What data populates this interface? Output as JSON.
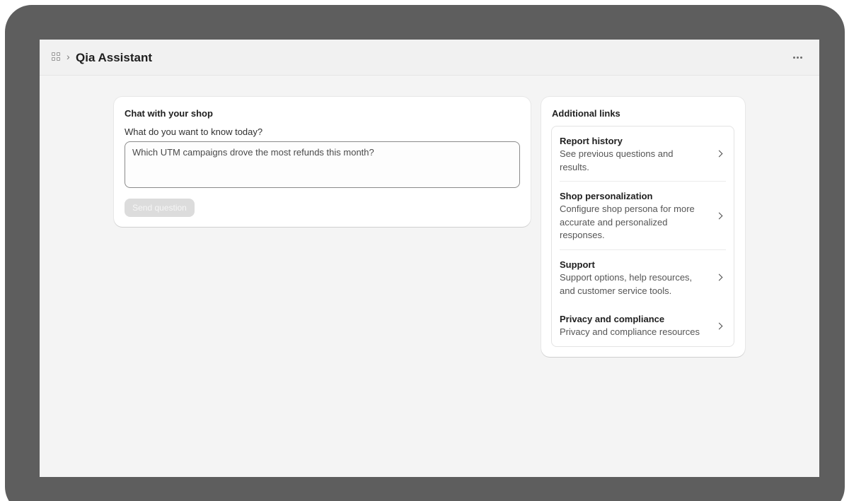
{
  "header": {
    "breadcrumb_separator": "›",
    "title": "Qia Assistant",
    "more_icon": "more-horizontal-icon"
  },
  "chat": {
    "title": "Chat with your shop",
    "label": "What do you want to know today?",
    "input_value": "Which UTM campaigns drove the most refunds this month?",
    "send_label": "Send question"
  },
  "links": {
    "title": "Additional links",
    "items": [
      {
        "title": "Report history",
        "description": "See previous questions and results."
      },
      {
        "title": "Shop personalization",
        "description": "Configure shop persona for more accurate and personalized responses."
      },
      {
        "title": "Support",
        "description": "Support options, help resources, and customer service tools."
      },
      {
        "title": "Privacy and compliance",
        "description": "Privacy and compliance resources"
      }
    ]
  },
  "colors": {
    "device_frame": "#5e5e5e",
    "page_background": "#f4f4f4",
    "disabled_button": "#dcdcdc"
  }
}
